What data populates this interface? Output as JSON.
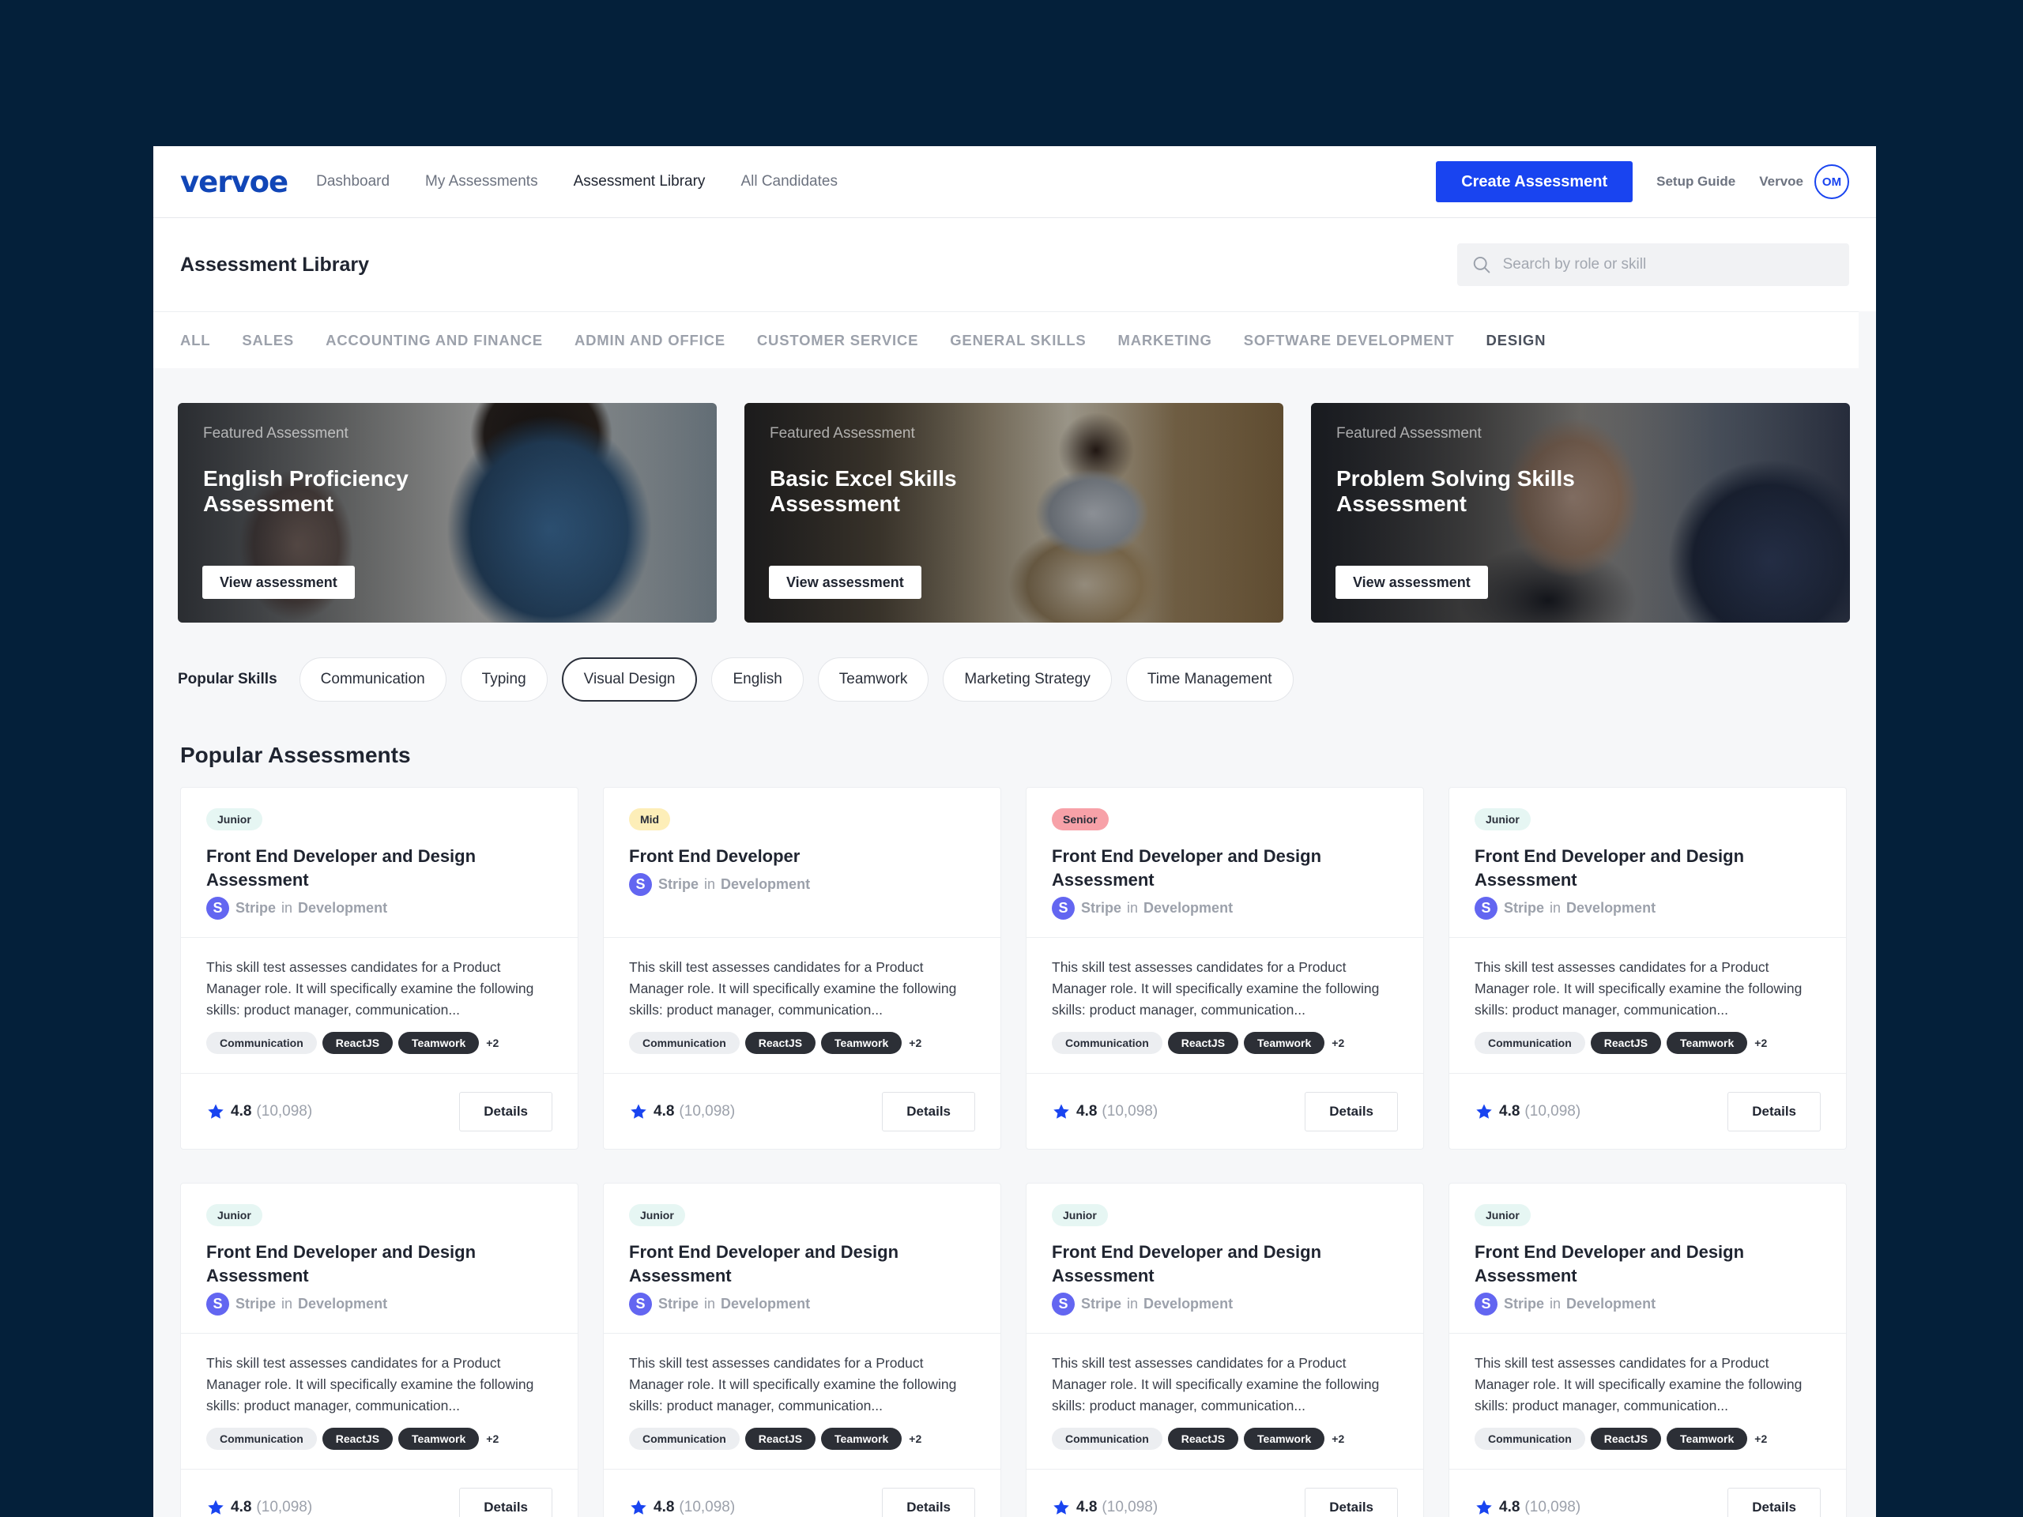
{
  "nav": {
    "logo": "vervoe",
    "links": [
      "Dashboard",
      "My Assessments",
      "Assessment Library",
      "All Candidates"
    ],
    "active_index": 2,
    "create_button": "Create Assessment",
    "setup_guide": "Setup Guide",
    "user_name": "Vervoe",
    "avatar_initials": "OM"
  },
  "header": {
    "title": "Assessment Library",
    "search_placeholder": "Search by role or skill"
  },
  "tabs": {
    "items": [
      "ALL",
      "SALES",
      "ACCOUNTING AND FINANCE",
      "ADMIN AND OFFICE",
      "CUSTOMER SERVICE",
      "GENERAL SKILLS",
      "MARKETING",
      "SOFTWARE DEVELOPMENT",
      "DESIGN"
    ],
    "active_index": 8
  },
  "featured": [
    {
      "kicker": "Featured Assessment",
      "title": "English Proficiency Assessment",
      "button": "View assessment"
    },
    {
      "kicker": "Featured Assessment",
      "title": "Basic Excel Skills Assessment",
      "button": "View assessment"
    },
    {
      "kicker": "Featured Assessment",
      "title": "Problem Solving Skills Assessment",
      "button": "View assessment"
    }
  ],
  "skills": {
    "label": "Popular Skills",
    "items": [
      "Communication",
      "Typing",
      "Visual Design",
      "English",
      "Teamwork",
      "Marketing Strategy",
      "Time Management"
    ],
    "active_index": 2
  },
  "popular": {
    "title": "Popular Assessments",
    "cards": [
      {
        "level": "Junior",
        "title": "Front End Developer and Design Assessment",
        "company": "Stripe",
        "company_initial": "S",
        "in": "in",
        "dept": "Development",
        "desc": "This skill test assesses candidates for a Product Manager role. It will specifically examine the following skills: product manager, communication...",
        "tags": [
          "Communication",
          "ReactJS",
          "Teamwork"
        ],
        "more": "+2",
        "rating": "4.8",
        "count": "(10,098)",
        "button": "Details"
      },
      {
        "level": "Mid",
        "title": "Front End Developer",
        "company": "Stripe",
        "company_initial": "S",
        "in": "in",
        "dept": "Development",
        "desc": "This skill test assesses candidates for a Product Manager role. It will specifically examine the following skills: product manager, communication...",
        "tags": [
          "Communication",
          "ReactJS",
          "Teamwork"
        ],
        "more": "+2",
        "rating": "4.8",
        "count": "(10,098)",
        "button": "Details"
      },
      {
        "level": "Senior",
        "title": "Front End Developer and Design Assessment",
        "company": "Stripe",
        "company_initial": "S",
        "in": "in",
        "dept": "Development",
        "desc": "This skill test assesses candidates for a Product Manager role. It will specifically examine the following skills: product manager, communication...",
        "tags": [
          "Communication",
          "ReactJS",
          "Teamwork"
        ],
        "more": "+2",
        "rating": "4.8",
        "count": "(10,098)",
        "button": "Details"
      },
      {
        "level": "Junior",
        "title": "Front End Developer and Design Assessment",
        "company": "Stripe",
        "company_initial": "S",
        "in": "in",
        "dept": "Development",
        "desc": "This skill test assesses candidates for a Product Manager role. It will specifically examine the following skills: product manager, communication...",
        "tags": [
          "Communication",
          "ReactJS",
          "Teamwork"
        ],
        "more": "+2",
        "rating": "4.8",
        "count": "(10,098)",
        "button": "Details"
      },
      {
        "level": "Junior",
        "title": "Front End Developer and Design Assessment",
        "company": "Stripe",
        "company_initial": "S",
        "in": "in",
        "dept": "Development",
        "desc": "This skill test assesses candidates for a Product Manager role. It will specifically examine the following skills: product manager, communication...",
        "tags": [
          "Communication",
          "ReactJS",
          "Teamwork"
        ],
        "more": "+2",
        "rating": "4.8",
        "count": "(10,098)",
        "button": "Details"
      },
      {
        "level": "Junior",
        "title": "Front End Developer and Design Assessment",
        "company": "Stripe",
        "company_initial": "S",
        "in": "in",
        "dept": "Development",
        "desc": "This skill test assesses candidates for a Product Manager role. It will specifically examine the following skills: product manager, communication...",
        "tags": [
          "Communication",
          "ReactJS",
          "Teamwork"
        ],
        "more": "+2",
        "rating": "4.8",
        "count": "(10,098)",
        "button": "Details"
      },
      {
        "level": "Junior",
        "title": "Front End Developer and Design Assessment",
        "company": "Stripe",
        "company_initial": "S",
        "in": "in",
        "dept": "Development",
        "desc": "This skill test assesses candidates for a Product Manager role. It will specifically examine the following skills: product manager, communication...",
        "tags": [
          "Communication",
          "ReactJS",
          "Teamwork"
        ],
        "more": "+2",
        "rating": "4.8",
        "count": "(10,098)",
        "button": "Details"
      },
      {
        "level": "Junior",
        "title": "Front End Developer and Design Assessment",
        "company": "Stripe",
        "company_initial": "S",
        "in": "in",
        "dept": "Development",
        "desc": "This skill test assesses candidates for a Product Manager role. It will specifically examine the following skills: product manager, communication...",
        "tags": [
          "Communication",
          "ReactJS",
          "Teamwork"
        ],
        "more": "+2",
        "rating": "4.8",
        "count": "(10,098)",
        "button": "Details"
      }
    ]
  },
  "colors": {
    "background": "#04203a",
    "brand": "#1146b7",
    "primary": "#1944f0",
    "company_logo": "#6366f1",
    "level_junior": "#e6f6f3",
    "level_mid": "#fdeeb8",
    "level_senior": "#f7a1a8"
  }
}
